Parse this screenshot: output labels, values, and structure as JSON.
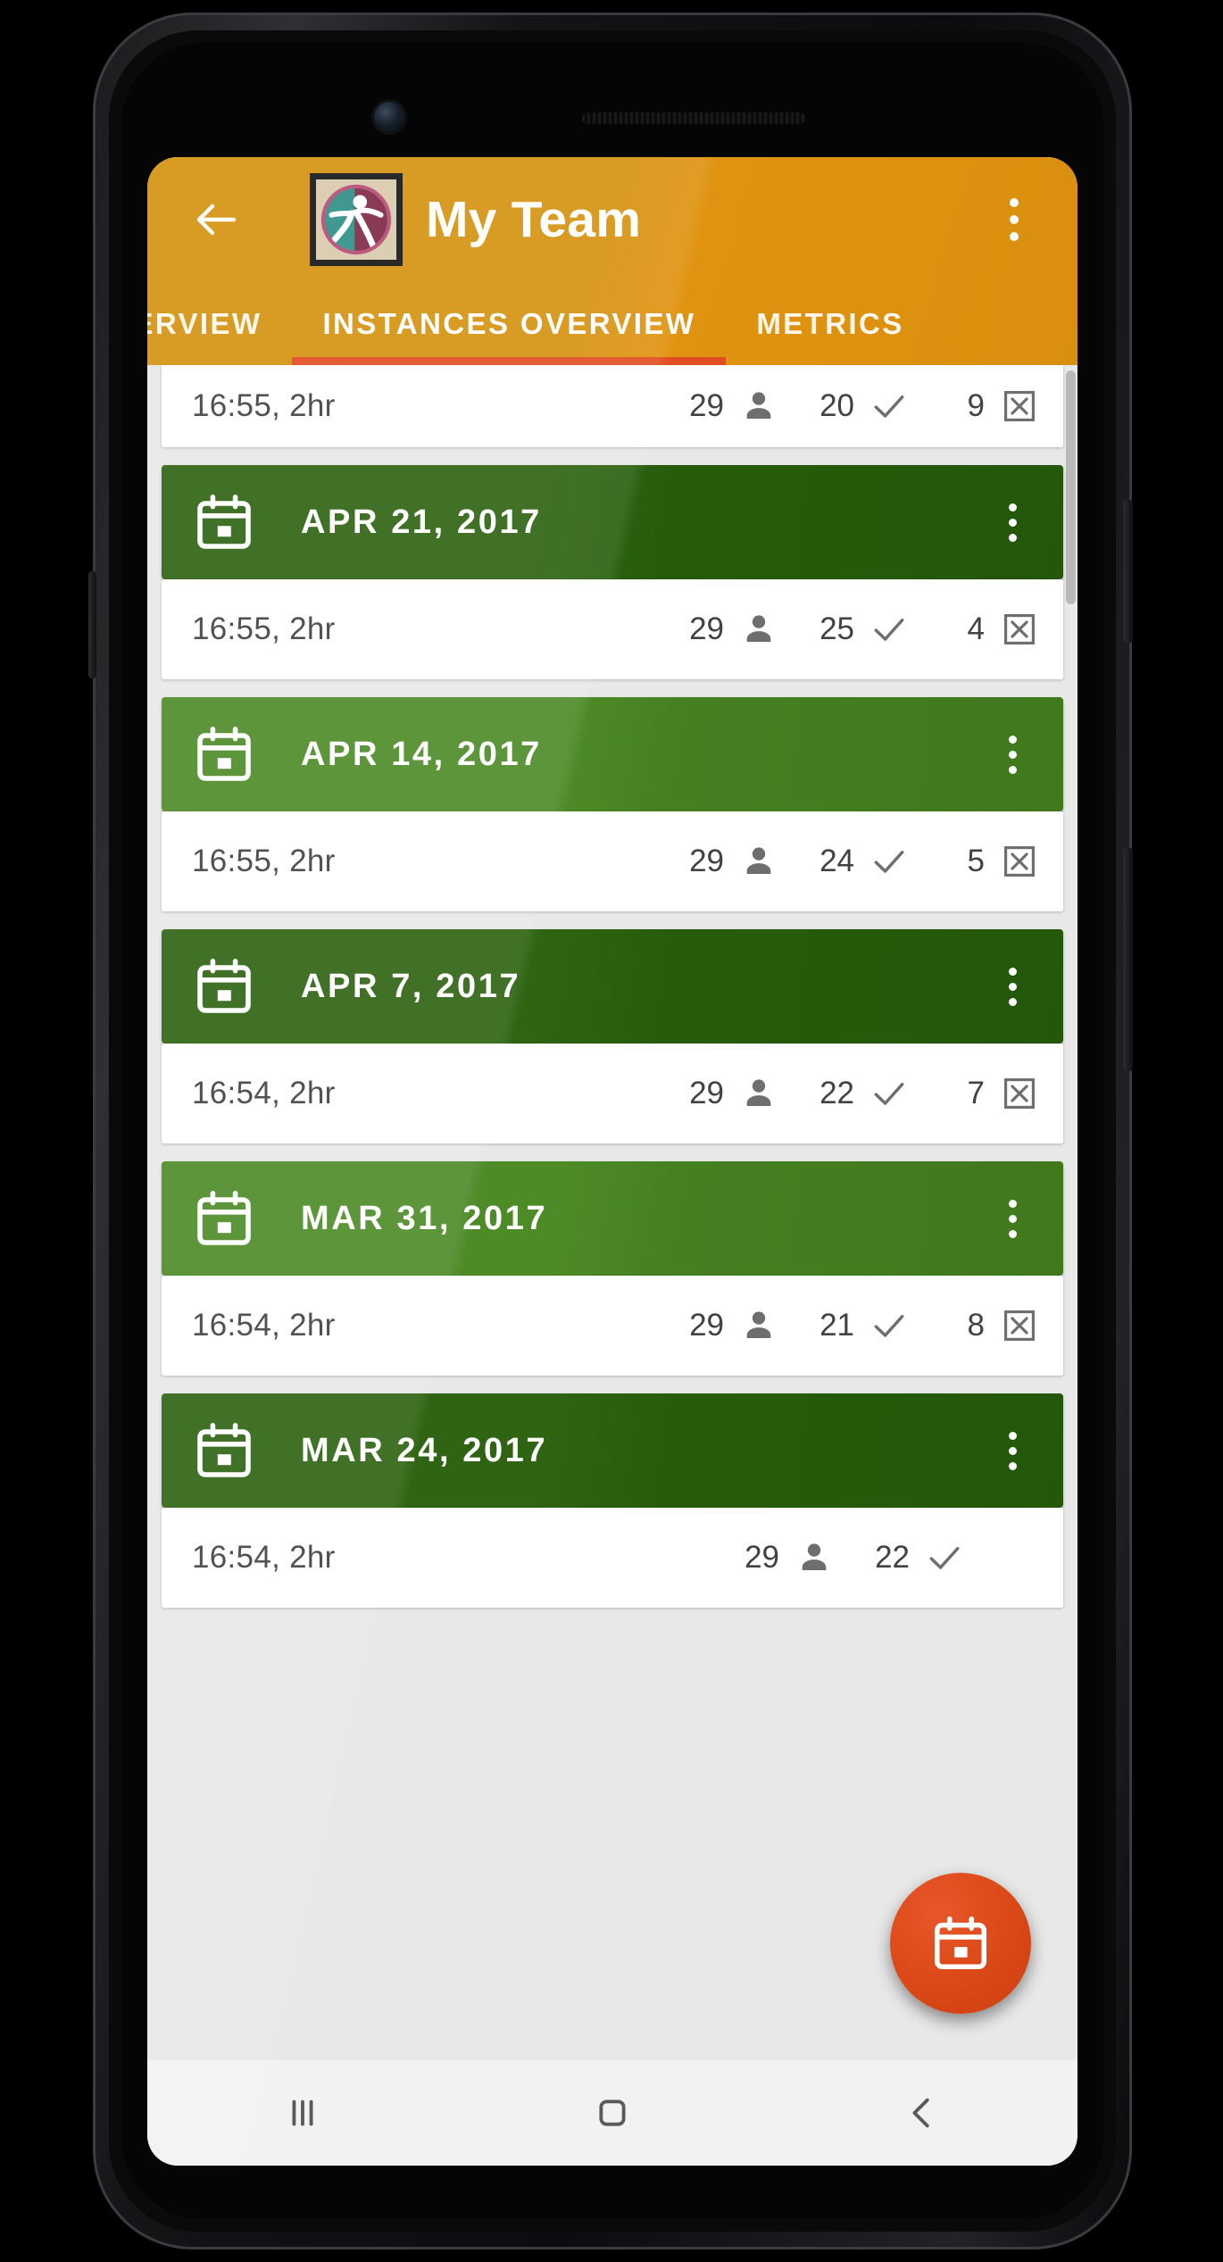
{
  "app_bar": {
    "back_label": "Back",
    "title": "My Team",
    "overflow_label": "More options",
    "background_color": "#d4920f"
  },
  "tabs": {
    "indicator_color": "#e04d20",
    "items": [
      {
        "label": "OVERVIEW",
        "active": false
      },
      {
        "label": "INSTANCES OVERVIEW",
        "active": true
      },
      {
        "label": "METRICS",
        "active": false
      }
    ]
  },
  "partial_row": {
    "time": "16:55, 2hr",
    "invited": "29",
    "attended": "20",
    "absent": "9"
  },
  "groups": [
    {
      "date": "APR 21, 2017",
      "shade": "dark",
      "instances": [
        {
          "time": "16:55, 2hr",
          "invited": "29",
          "attended": "25",
          "absent": "4"
        }
      ]
    },
    {
      "date": "APR 14, 2017",
      "shade": "light",
      "instances": [
        {
          "time": "16:55, 2hr",
          "invited": "29",
          "attended": "24",
          "absent": "5"
        }
      ]
    },
    {
      "date": "APR 7, 2017",
      "shade": "dark",
      "instances": [
        {
          "time": "16:54, 2hr",
          "invited": "29",
          "attended": "22",
          "absent": "7"
        }
      ]
    },
    {
      "date": "MAR 31, 2017",
      "shade": "light",
      "instances": [
        {
          "time": "16:54, 2hr",
          "invited": "29",
          "attended": "21",
          "absent": "8"
        }
      ]
    },
    {
      "date": "MAR 24, 2017",
      "shade": "dark",
      "instances": [
        {
          "time": "16:54, 2hr",
          "invited": "29",
          "attended": "22",
          "absent": ""
        }
      ]
    }
  ],
  "icons": {
    "back": "arrow-left-icon",
    "logo": "team-logo-icon",
    "overflow": "overflow-menu-icon",
    "calendar": "calendar-icon",
    "invited": "person-icon",
    "attended": "check-icon",
    "absent": "cancel-box-icon",
    "fab": "calendar-add-icon"
  },
  "fab": {
    "label": "Add instance",
    "color": "#da4817"
  },
  "android_nav": {
    "recents_label": "Recent apps",
    "home_label": "Home",
    "back_label": "Back"
  },
  "colors": {
    "app_bar": "#d4920f",
    "tab_indicator": "#e04d20",
    "date_header_dark": "#2e6412",
    "date_header_light": "#4d8b27",
    "row_background": "#ffffff",
    "list_background": "#e8e8e8",
    "text_primary": "#424242",
    "fab": "#da4817"
  }
}
